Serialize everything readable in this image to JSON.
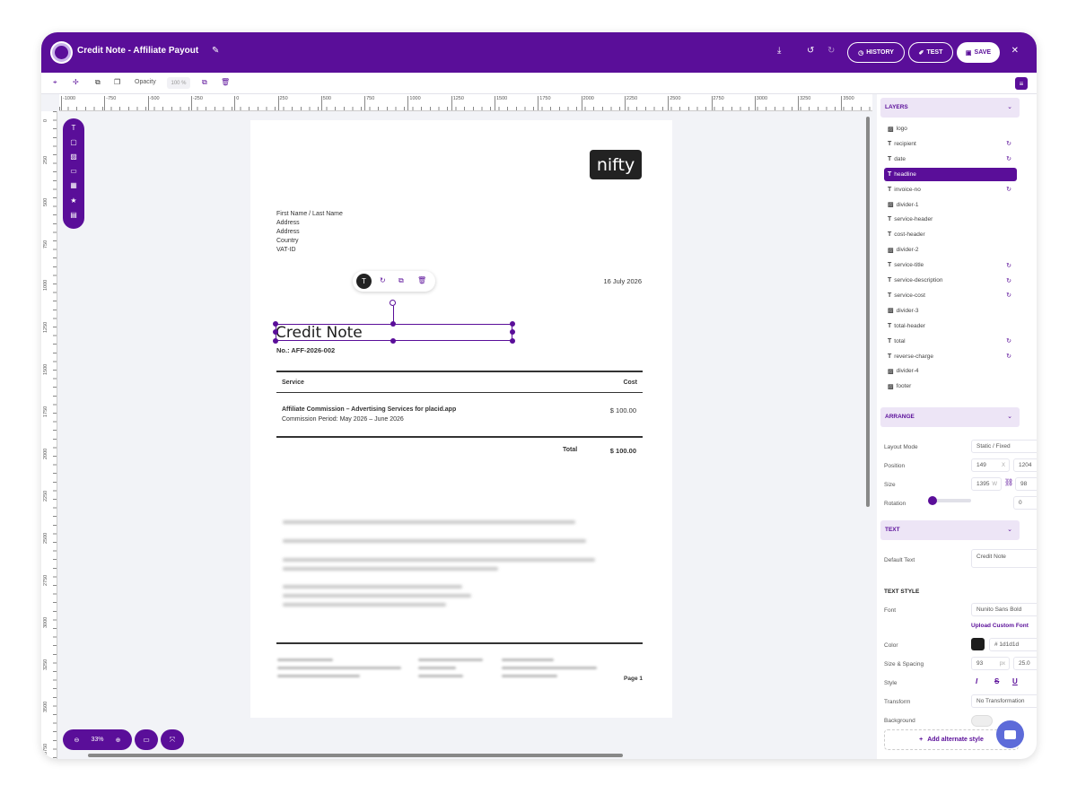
{
  "titlebar": {
    "title": "Credit Note - Affiliate Payout",
    "history_label": "HISTORY",
    "test_label": "TEST",
    "save_label": "SAVE"
  },
  "toolbar": {
    "opacity_label": "Opacity",
    "opacity_value": "100 %"
  },
  "ruler_top": [
    "-1000",
    "-750",
    "-500",
    "-250",
    "0",
    "250",
    "500",
    "750",
    "1000",
    "1250",
    "1500",
    "1750",
    "2000",
    "2250",
    "2500",
    "2750",
    "3000",
    "3250",
    "3500"
  ],
  "ruler_left": [
    "0",
    "250",
    "500",
    "750",
    "1000",
    "1250",
    "1500",
    "1750",
    "2000",
    "2250",
    "2500",
    "2750",
    "3000",
    "3250",
    "3500",
    "3750"
  ],
  "document": {
    "logo_text": "nifty",
    "address_lines": [
      "First Name / Last Name",
      "Address",
      "Address",
      "Country",
      "VAT-ID"
    ],
    "date": "16 July 2026",
    "headline": "Credit Note",
    "invoice_no": "No.: AFF-2026-002",
    "service_header": "Service",
    "cost_header": "Cost",
    "service_title": "Affiliate Commission – Advertising Services for placid.app",
    "service_description": "Commission Period: May 2026 – June 2026",
    "service_cost": "$ 100.00",
    "total_header": "Total",
    "total": "$ 100.00",
    "page_number": "Page 1"
  },
  "zoom": {
    "value": "33%"
  },
  "panel": {
    "layers_title": "LAYERS",
    "layers": [
      {
        "name": "logo",
        "type": "image",
        "sync": false,
        "active": false
      },
      {
        "name": "recipient",
        "type": "text",
        "sync": true,
        "active": false
      },
      {
        "name": "date",
        "type": "text",
        "sync": true,
        "active": false
      },
      {
        "name": "headline",
        "type": "text",
        "sync": false,
        "active": true
      },
      {
        "name": "invoice-no",
        "type": "text",
        "sync": true,
        "active": false
      },
      {
        "name": "divider-1",
        "type": "image",
        "sync": false,
        "active": false
      },
      {
        "name": "service-header",
        "type": "text",
        "sync": false,
        "active": false
      },
      {
        "name": "cost-header",
        "type": "text",
        "sync": false,
        "active": false
      },
      {
        "name": "divider-2",
        "type": "image",
        "sync": false,
        "active": false
      },
      {
        "name": "service-title",
        "type": "text",
        "sync": true,
        "active": false
      },
      {
        "name": "service-description",
        "type": "text",
        "sync": true,
        "active": false
      },
      {
        "name": "service-cost",
        "type": "text",
        "sync": true,
        "active": false
      },
      {
        "name": "divider-3",
        "type": "image",
        "sync": false,
        "active": false
      },
      {
        "name": "total-header",
        "type": "text",
        "sync": false,
        "active": false
      },
      {
        "name": "total",
        "type": "text",
        "sync": true,
        "active": false
      },
      {
        "name": "reverse-charge",
        "type": "text",
        "sync": true,
        "active": false
      },
      {
        "name": "divider-4",
        "type": "image",
        "sync": false,
        "active": false
      },
      {
        "name": "footer",
        "type": "image",
        "sync": false,
        "active": false
      }
    ],
    "arrange_title": "ARRANGE",
    "layout_mode_label": "Layout Mode",
    "layout_mode_value": "Static / Fixed",
    "position_label": "Position",
    "pos_x": "149",
    "pos_x_suffix": "X",
    "pos_y": "1204",
    "pos_y_suffix": "Y",
    "size_label": "Size",
    "size_w": "1395",
    "size_w_suffix": "W",
    "size_h": "98",
    "size_h_suffix": "H",
    "rotation_label": "Rotation",
    "rotation_value": "0",
    "rotation_suffix": "°",
    "text_title": "TEXT",
    "default_text_label": "Default Text",
    "default_text_value": "Credit Note",
    "text_style_title": "TEXT STYLE",
    "font_label": "Font",
    "font_value": "Nunito Sans Bold",
    "upload_font_label": "Upload Custom Font",
    "color_label": "Color",
    "color_value": "# 1d1d1d",
    "color_hex": "#1d1d1d",
    "size_spacing_label": "Size & Spacing",
    "font_size": "93",
    "font_size_suffix": "px",
    "spacing": "25.0",
    "spacing_suffix": "px",
    "style_label": "Style",
    "transform_label": "Transform",
    "transform_value": "No Transformation",
    "background_label": "Background",
    "add_alt_style_label": "Add alternate style"
  },
  "colors": {
    "brand": "#5a0e99",
    "chat": "#5d6bd9"
  }
}
